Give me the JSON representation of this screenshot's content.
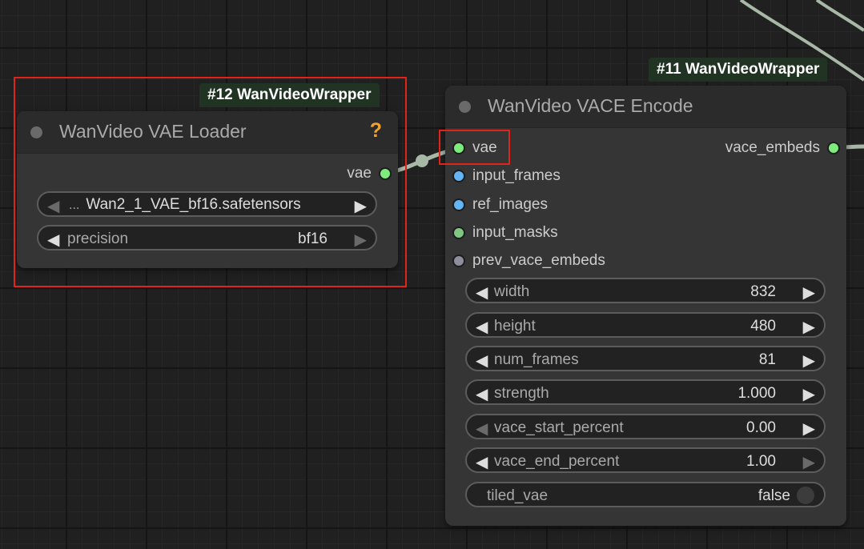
{
  "colors": {
    "slot_vae": "#7dec7d",
    "slot_image": "#64b5f6",
    "slot_mask": "#81c784",
    "slot_embeds": "#8e8e9e",
    "link": "#a8b8a6",
    "help": "#f0a22f",
    "badge_bg": "#213322",
    "highlight": "#e0241a"
  },
  "vae_loader": {
    "badge": "#12 WanVideoWrapper",
    "title": "WanVideo VAE Loader",
    "help_icon": "question-mark-icon",
    "output": {
      "label": "vae"
    },
    "model_name": {
      "ellipsis": "...",
      "value": "Wan2_1_VAE_bf16.safetensors"
    },
    "precision": {
      "label": "precision",
      "value": "bf16"
    }
  },
  "vace_encode": {
    "badge": "#11 WanVideoWrapper",
    "title": "WanVideo VACE Encode",
    "inputs": [
      {
        "label": "vae"
      },
      {
        "label": "input_frames"
      },
      {
        "label": "ref_images"
      },
      {
        "label": "input_masks"
      },
      {
        "label": "prev_vace_embeds"
      }
    ],
    "output": {
      "label": "vace_embeds"
    },
    "widgets": [
      {
        "label": "width",
        "value": "832"
      },
      {
        "label": "height",
        "value": "480"
      },
      {
        "label": "num_frames",
        "value": "81"
      },
      {
        "label": "strength",
        "value": "1.000"
      },
      {
        "label": "vace_start_percent",
        "value": "0.00"
      },
      {
        "label": "vace_end_percent",
        "value": "1.00"
      }
    ],
    "tiled_vae": {
      "label": "tiled_vae",
      "value": "false"
    }
  }
}
